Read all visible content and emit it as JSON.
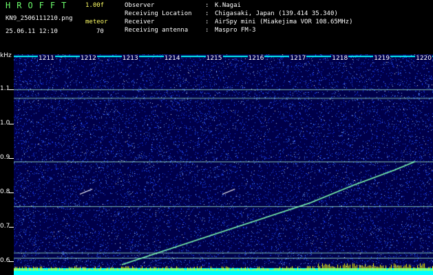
{
  "header": {
    "app_title": "HROFFT",
    "version": "1.00f",
    "filename": "KN9_2506111210.png",
    "meteor_label": "meteor",
    "datetime": "25.06.11 12:10",
    "meteor_count": "70"
  },
  "info": [
    {
      "label": "Observer",
      "sep": ":",
      "value": "K.Nagai"
    },
    {
      "label": "Receiving Location",
      "sep": ":",
      "value": "Chigasaki, Japan (139.414 35.340)"
    },
    {
      "label": "Receiver",
      "sep": ":",
      "value": "AirSpy mini (Miakejima VOR 108.65MHz)"
    },
    {
      "label": "Receiving antenna",
      "sep": ":",
      "value": "Maspro FM-3"
    }
  ],
  "colors": {
    "background": "#00004a",
    "noise": [
      "#1a3cff",
      "#2f6bff",
      "#6ea0ff",
      "#b0d0ff",
      "#ffffff"
    ],
    "signal": "#7dffb0",
    "strip": "#00ffff",
    "bars": "#ffff00"
  },
  "chart_data": {
    "type": "heatmap",
    "title": "",
    "ylabel": "kHz",
    "y_ticks": [
      "1.1",
      "1.0",
      "0.9",
      "0.8",
      "0.7",
      "0.6"
    ],
    "x_ticks": [
      "1211",
      "1212",
      "1213",
      "1214",
      "1215",
      "1216",
      "1217",
      "1218",
      "1219",
      "1220"
    ],
    "horizontal_lines": [
      {
        "freq_khz": 1.1
      },
      {
        "freq_khz": 1.075
      },
      {
        "freq_khz": 0.89
      },
      {
        "freq_khz": 0.76
      },
      {
        "freq_khz": 0.625
      },
      {
        "freq_khz": 0.61
      }
    ],
    "meteor_echoes": [
      {
        "t_start": 1212.0,
        "f_start": 0.795,
        "t_end": 1212.3,
        "f_end": 0.81
      },
      {
        "t_start": 1215.4,
        "f_start": 0.795,
        "t_end": 1215.7,
        "f_end": 0.81
      }
    ],
    "drift_trace": [
      {
        "t": 1213.0,
        "f": 0.59
      },
      {
        "t": 1214.5,
        "f": 0.65
      },
      {
        "t": 1216.5,
        "f": 0.73
      },
      {
        "t": 1217.5,
        "f": 0.77
      },
      {
        "t": 1218.5,
        "f": 0.82
      },
      {
        "t": 1219.5,
        "f": 0.865
      },
      {
        "t": 1220.0,
        "f": 0.89
      }
    ]
  }
}
